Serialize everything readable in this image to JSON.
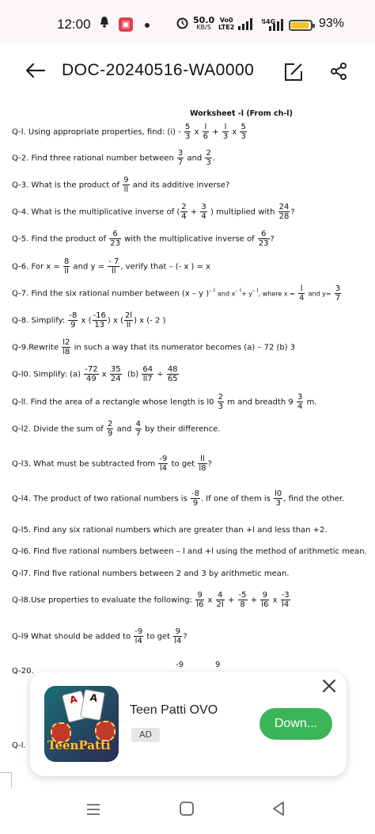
{
  "status_bar": {
    "time": "12:00",
    "net_speed_value": "50.0",
    "net_speed_unit": "KB/S",
    "volte_top": "Vo0",
    "volte_bottom": "LTE2",
    "network": "4G",
    "battery_percent": "93%",
    "battery_level": 0.93
  },
  "toolbar": {
    "title": "DOC-20240516-WA0000"
  },
  "document": {
    "heading": "Worksheet -l (From ch-l)",
    "q1": {
      "label": "Q-l. Using appropriate properties, find: (i) -",
      "f1n": "5",
      "f1d": "3",
      "x1": "x",
      "f2n": "l",
      "f2d": "6",
      "plus": "+",
      "f3n": "l",
      "f3d": "3",
      "x2": "x",
      "f4n": "5",
      "f4d": "3"
    },
    "q2": {
      "label": "Q-2. Find three rational number between",
      "f1n": "3",
      "f1d": "7",
      "and": "and",
      "f2n": "2",
      "f2d": "3",
      "end": "."
    },
    "q3": {
      "label": "Q-3. What is the product of",
      "fn": "9",
      "fd": "ll",
      "end": "and its additive inverse?"
    },
    "q4": {
      "label": "Q-4. What is the multiplicative inverse of (",
      "f1n": "2",
      "f1d": "4",
      "plus": "+",
      "f2n": "3",
      "f2d": "4",
      "mid": ") multiplied with",
      "f3n": "24",
      "f3d": "28",
      "end": "?"
    },
    "q5": {
      "label": "Q-5. Find the product of",
      "f1n": "6",
      "f1d": "23",
      "mid": "with the multiplicative inverse of",
      "f2n": "6",
      "f2d": "23",
      "end": "?"
    },
    "q6": {
      "label": "Q-6. For x =",
      "f1n": "8",
      "f1d": "ll",
      "mid": "and y =",
      "f2n": "- 7",
      "f2d": "ll",
      "end": ", verify that – (- x ) = x"
    },
    "q7": {
      "label": "Q-7. Find the six rational number between (x – y )",
      "sup1": "– l",
      "mid1": "and x",
      "sup2": "– l",
      "mid2": "+ y",
      "sup3": "– l",
      "mid3": ", where x =",
      "f1n": "l",
      "f1d": "4",
      "mid4": "and y=",
      "f2n": "3",
      "f2d": "7"
    },
    "q8": {
      "label": "Q-8. Simplify:",
      "f1n": "-8",
      "f1d": "9",
      "x1": "x (",
      "f2n": "-16",
      "f2d": "13",
      "x2": ") x (",
      "f3n": "2l",
      "f3d": "ll",
      "end": ") x (- 2 )"
    },
    "q9": {
      "label": "Q-9.Rewrite",
      "fn": "l2",
      "fd": "l8",
      "end": "in  such a way that its numerator becomes (a) – 72  (b) 3"
    },
    "q10": {
      "label": "Q-l0. Simplify: (a)",
      "f1n": "-72",
      "f1d": "49",
      "x": "x",
      "f2n": "35",
      "f2d": "24",
      "b": "(b)",
      "f3n": "64",
      "f3d": "ll7",
      "div": "÷",
      "f4n": "48",
      "f4d": "65"
    },
    "q11": {
      "label": "Q-ll. Find the area of a rectangle whose length is l0",
      "f1n": "2",
      "f1d": "3",
      "mid": "m and breadth 9",
      "f2n": "3",
      "f2d": "4",
      "end": "m."
    },
    "q12": {
      "label": "Q-l2. Divide the sum of",
      "f1n": "2",
      "f1d": "9",
      "and": "and",
      "f2n": "4",
      "f2d": "7",
      "end": "by their difference."
    },
    "q13": {
      "label": "Q-l3. What must be subtracted from",
      "f1n": "-9",
      "f1d": "l4",
      "mid": "to get",
      "f2n": "ll",
      "f2d": "l8",
      "end": "?"
    },
    "q14": {
      "label": "Q-l4. The product of two rational numbers is",
      "f1n": "-8",
      "f1d": "9",
      "mid": ". If  one of them is",
      "f2n": "l0",
      "f2d": "3",
      "end": ", find the other."
    },
    "q15": {
      "label": "Q-l5. Find any six rational numbers which are greater than +l and less than +2."
    },
    "q16": {
      "label": "Q-l6. Find five rational numbers between – l  and +l using the method of arithmetic mean."
    },
    "q17": {
      "label": "Q-l7. Find five rational numbers between 2 and 3 by arithmetic mean."
    },
    "q18": {
      "label": "Q-l8.Use properties to evaluate the following:",
      "f1n": "9",
      "f1d": "l6",
      "x1": "x",
      "f2n": "4",
      "f2d": "2l",
      "p1": "+",
      "f3n": "-5",
      "f3d": "8",
      "p2": "+",
      "f4n": "9",
      "f4d": "l6",
      "x2": "x",
      "f5n": "-3",
      "f5d": "l4"
    },
    "q19": {
      "label": "Q-l9 What should be added to",
      "f1n": "-9",
      "f1d": "l4",
      "mid": "to get",
      "f2n": "9",
      "f2d": "l4",
      "end": "?"
    },
    "q20": {
      "label": "Q-20.",
      "n1": "-9",
      "n2": "9"
    },
    "q21": {
      "label": "Q-l."
    }
  },
  "ad": {
    "title": "Teen Patti OVO",
    "tag": "AD",
    "button": "Down...",
    "image_text": "TeenPatti",
    "card1": "A",
    "card2": "A"
  }
}
